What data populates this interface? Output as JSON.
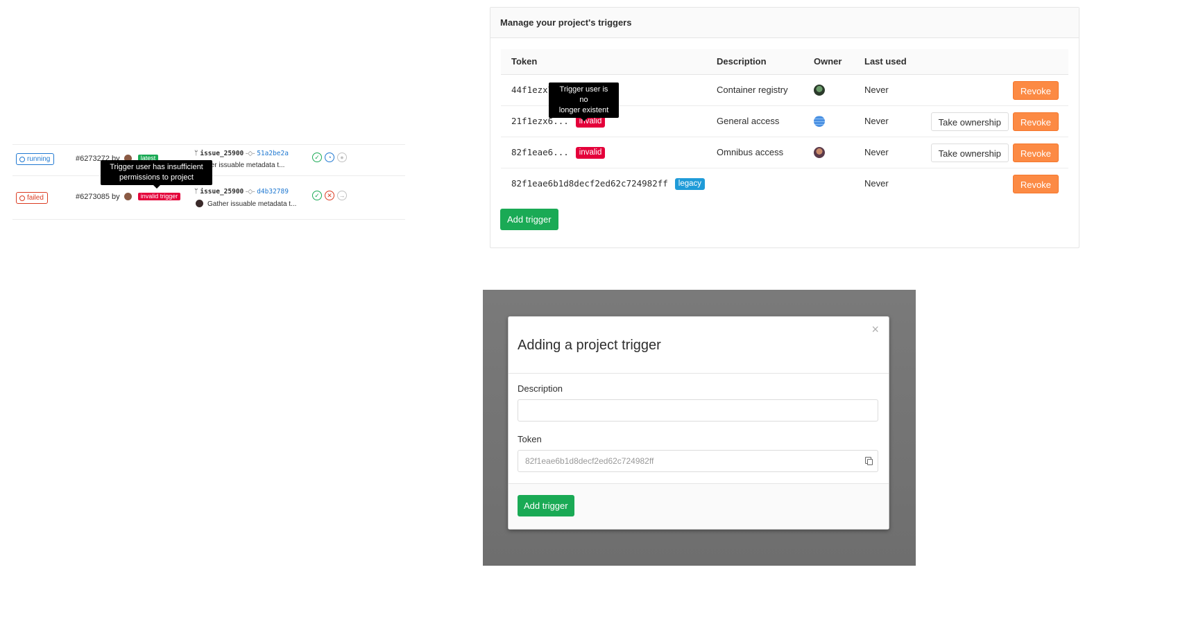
{
  "pipelines": {
    "rows": [
      {
        "status": "running",
        "pipeline_id": "#6273272",
        "by": "by",
        "tag": "latest",
        "branch": "issue_25900",
        "commit_sha": "51a2be2a",
        "commit_message": "Gather issuable metadata t..."
      },
      {
        "status": "failed",
        "pipeline_id": "#6273085",
        "by": "by",
        "tag": "invalid trigger",
        "branch": "issue_25900",
        "commit_sha": "d4b32789",
        "commit_message": "Gather issuable metadata t..."
      }
    ],
    "tooltip": "Trigger user has insufficient\npermissions to project"
  },
  "triggers_panel": {
    "title": "Manage your project's triggers",
    "columns": {
      "token": "Token",
      "description": "Description",
      "owner": "Owner",
      "last_used": "Last used"
    },
    "rows": [
      {
        "token": "44f1ezx7...",
        "label": "",
        "description": "Container registry",
        "last_used": "Never",
        "take_ownership": "",
        "revoke": "Revoke"
      },
      {
        "token": "21f1ezx6...",
        "label": "invalid",
        "description": "General access",
        "last_used": "Never",
        "take_ownership": "Take ownership",
        "revoke": "Revoke"
      },
      {
        "token": "82f1eae6...",
        "label": "invalid",
        "description": "Omnibus access",
        "last_used": "Never",
        "take_ownership": "Take ownership",
        "revoke": "Revoke"
      },
      {
        "token": "82f1eae6b1d8decf2ed62c724982ff",
        "label": "legacy",
        "description": "",
        "last_used": "Never",
        "take_ownership": "",
        "revoke": "Revoke"
      }
    ],
    "tooltip": "Trigger user is no\nlonger existent",
    "add_button": "Add trigger"
  },
  "modal": {
    "close": "×",
    "title": "Adding a project trigger",
    "description_label": "Description",
    "description_value": "",
    "token_label": "Token",
    "token_value": "82f1eae6b1d8decf2ed62c724982ff",
    "add_button": "Add trigger"
  },
  "colors": {
    "success": "#1aaa55",
    "revoke": "#fc8a44",
    "invalid": "#e4003a",
    "legacy": "#1f9bd8",
    "running": "#1f78d1",
    "failed": "#db3b21"
  }
}
